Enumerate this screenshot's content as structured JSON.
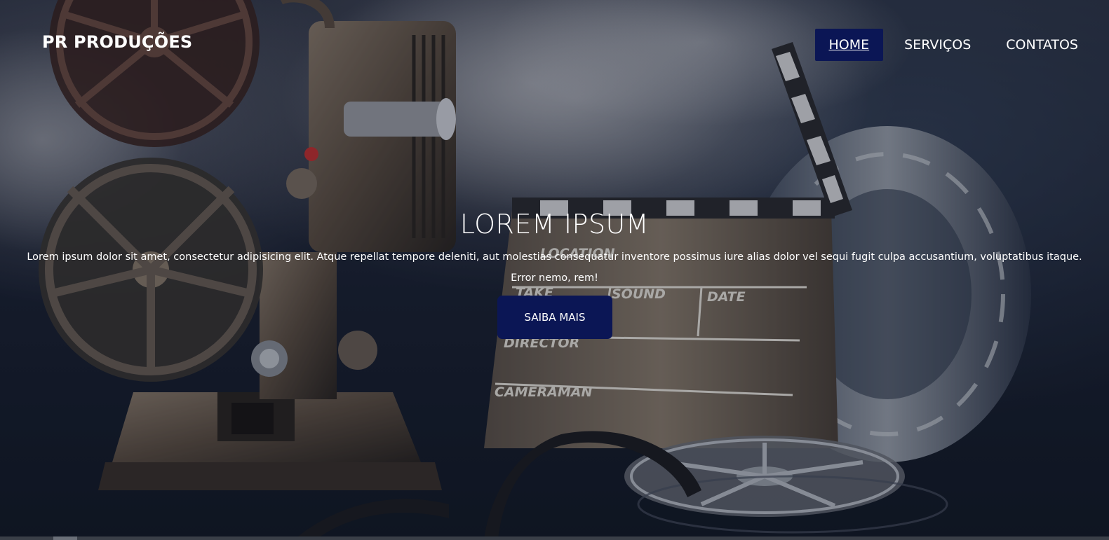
{
  "brand": {
    "name": "PR PRODUÇÕES"
  },
  "nav": {
    "items": [
      {
        "label": "HOME",
        "active": true
      },
      {
        "label": "SERVIÇOS",
        "active": false
      },
      {
        "label": "CONTATOS",
        "active": false
      }
    ]
  },
  "hero": {
    "title": "LOREM IPSUM",
    "text": "Lorem ipsum dolor sit amet, consectetur adipisicing elit. Atque repellat tempore deleniti, aut molestias consequatur inventore possimus iure alias dolor vel sequi fugit culpa accusantium, voluptatibus itaque. Error nemo, rem!",
    "button_label": "SAIBA MAIS",
    "background_image": {
      "clapperboard_labels": [
        "LOCATION",
        "TAKE",
        "SOUND",
        "DATE",
        "DIRECTOR",
        "CAMERAMAN"
      ]
    }
  },
  "colors": {
    "accent": "#0b1655",
    "text": "#ffffff"
  }
}
